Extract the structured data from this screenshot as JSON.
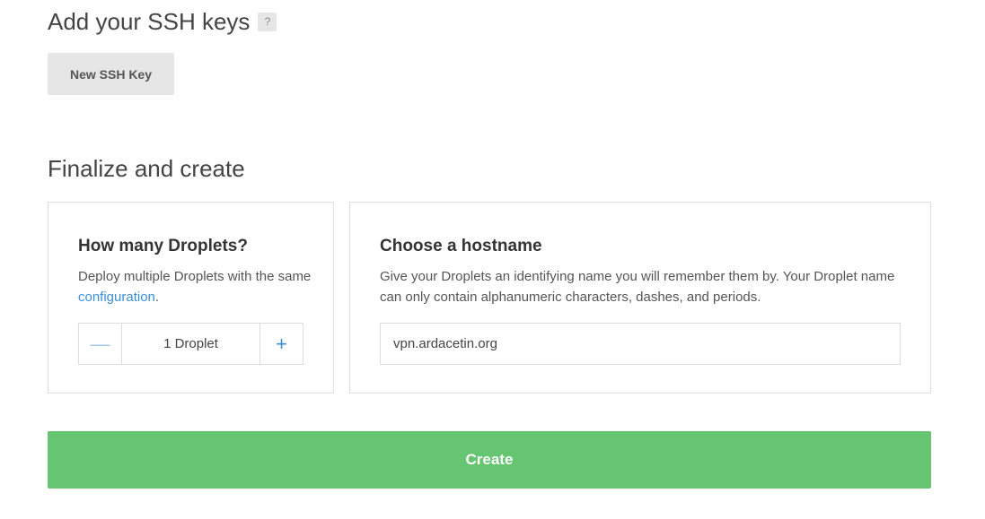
{
  "ssh_section": {
    "heading": "Add your SSH keys",
    "help_label": "?",
    "new_key_button": "New SSH Key"
  },
  "finalize_section": {
    "heading": "Finalize and create",
    "droplets_panel": {
      "title": "How many Droplets?",
      "desc_prefix": "Deploy multiple Droplets with the same ",
      "desc_link": "configuration",
      "desc_suffix": ".",
      "stepper": {
        "minus_glyph": "—",
        "value": "1 Droplet",
        "plus_glyph": "+"
      }
    },
    "hostname_panel": {
      "title": "Choose a hostname",
      "description": "Give your Droplets an identifying name you will remember them by. Your Droplet name can only contain alphanumeric characters, dashes, and periods.",
      "input_value": "vpn.ardacetin.org"
    }
  },
  "create_button": "Create",
  "colors": {
    "create_green": "#66c571",
    "link_blue": "#3a8fd6",
    "button_gray": "#e6e6e6",
    "border_gray": "#dfdfdf"
  }
}
